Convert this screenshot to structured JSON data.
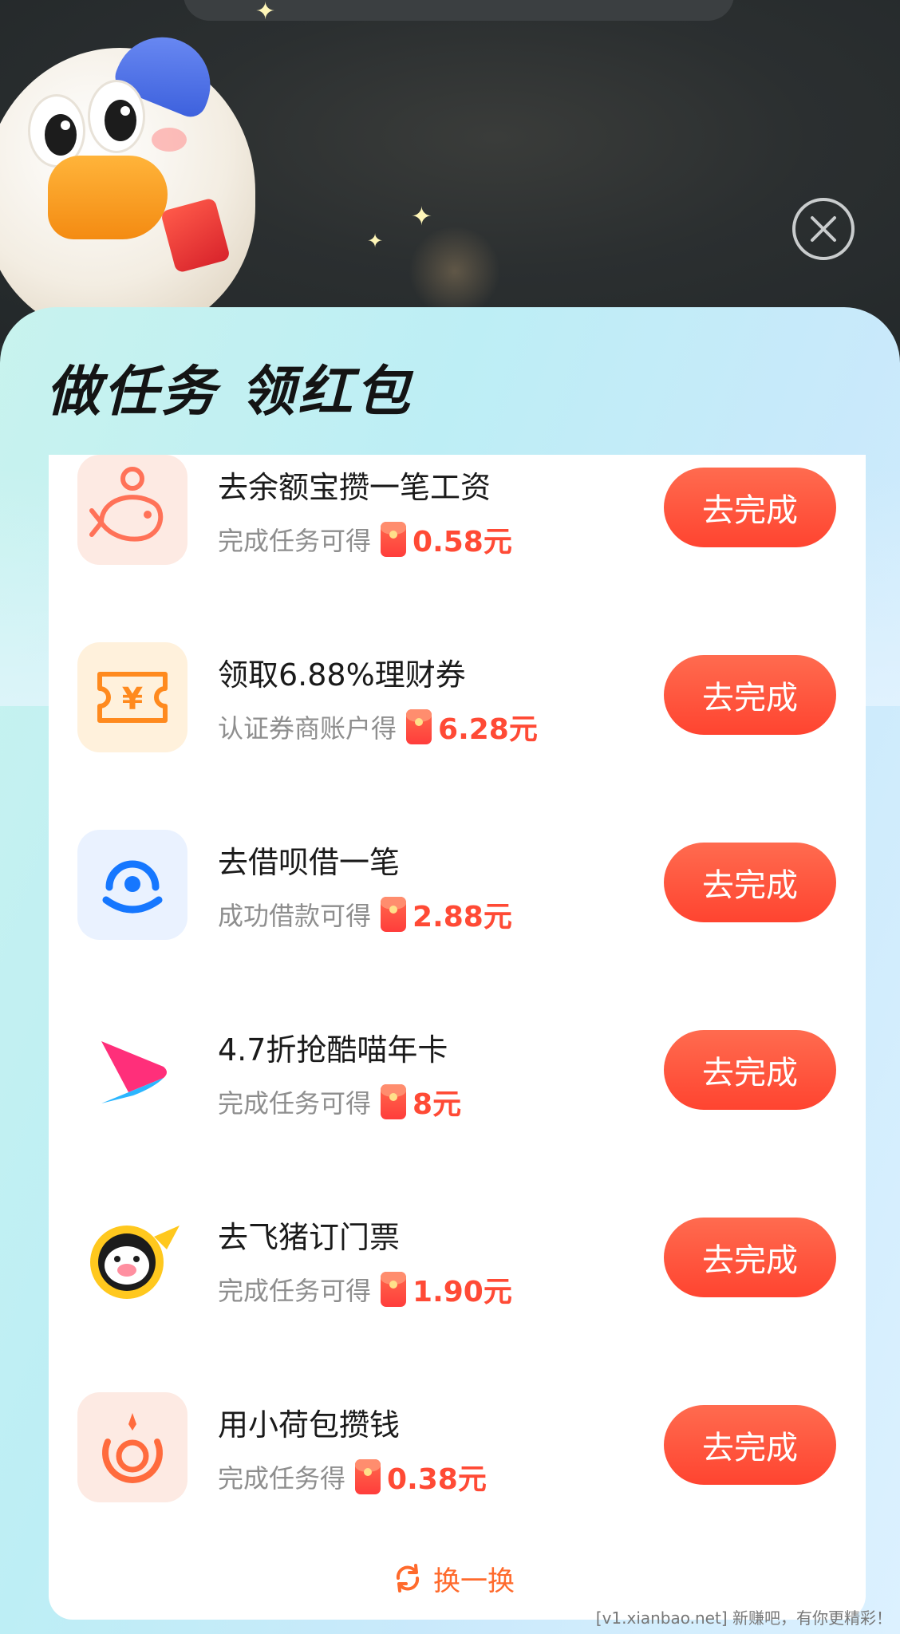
{
  "header": {
    "title": "做任务 领红包"
  },
  "tasks": [
    {
      "icon": "yuebao-fish-icon",
      "title": "去余额宝攒一笔工资",
      "desc": "完成任务可得",
      "amount": "0.58元",
      "button": "去完成"
    },
    {
      "icon": "finance-coupon-icon",
      "title": "领取6.88%理财券",
      "desc": "认证券商账户得",
      "amount": "6.28元",
      "button": "去完成"
    },
    {
      "icon": "jiebei-icon",
      "title": "去借呗借一笔",
      "desc": "成功借款可得",
      "amount": "2.88元",
      "button": "去完成"
    },
    {
      "icon": "youku-play-icon",
      "title": "4.7折抢酷喵年卡",
      "desc": "完成任务可得",
      "amount": "8元",
      "button": "去完成"
    },
    {
      "icon": "fliggy-pig-icon",
      "title": "去飞猪订门票",
      "desc": "完成任务可得",
      "amount": "1.90元",
      "button": "去完成"
    },
    {
      "icon": "xiaohebao-icon",
      "title": "用小荷包攒钱",
      "desc": "完成任务得",
      "amount": "0.38元",
      "button": "去完成"
    }
  ],
  "footer": {
    "refresh_label": "换一换"
  },
  "watermark": "[v1.xianbao.net] 新赚吧，有你更精彩！",
  "colors": {
    "accent": "#ff4a35",
    "button": "#ff5a3c",
    "refresh": "#ff6a2c"
  }
}
